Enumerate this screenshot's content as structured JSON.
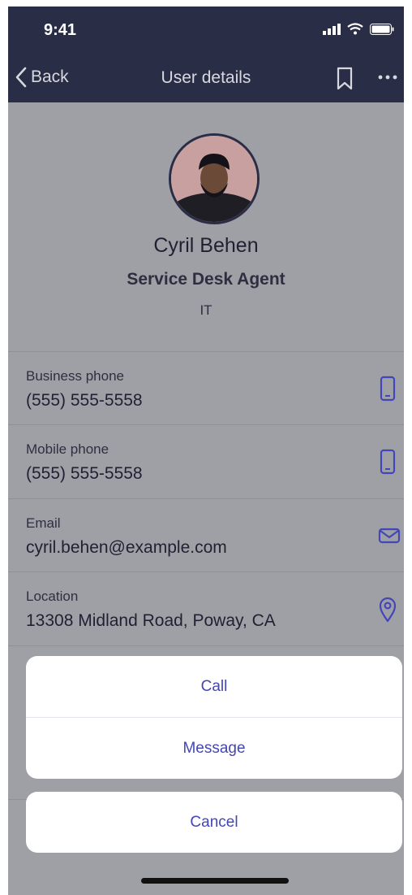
{
  "status_bar": {
    "time": "9:41"
  },
  "nav": {
    "back_label": "Back",
    "title": "User details"
  },
  "profile": {
    "name": "Cyril Behen",
    "job_title": "Service Desk Agent",
    "department": "IT"
  },
  "details": [
    {
      "label": "Business phone",
      "value": "(555) 555-5558",
      "icon": "phone-icon"
    },
    {
      "label": "Mobile phone",
      "value": "(555) 555-5558",
      "icon": "phone-icon"
    },
    {
      "label": "Email",
      "value": "cyril.behen@example.com",
      "icon": "mail-icon"
    },
    {
      "label": "Location",
      "value": "13308 Midland Road, Poway, CA",
      "icon": "location-pin-icon"
    }
  ],
  "action_sheet": {
    "call_label": "Call",
    "message_label": "Message",
    "cancel_label": "Cancel"
  },
  "colors": {
    "navbar": "#2a2d46",
    "accent": "#4346b8",
    "dim_overlay": "#9fa0a6"
  }
}
